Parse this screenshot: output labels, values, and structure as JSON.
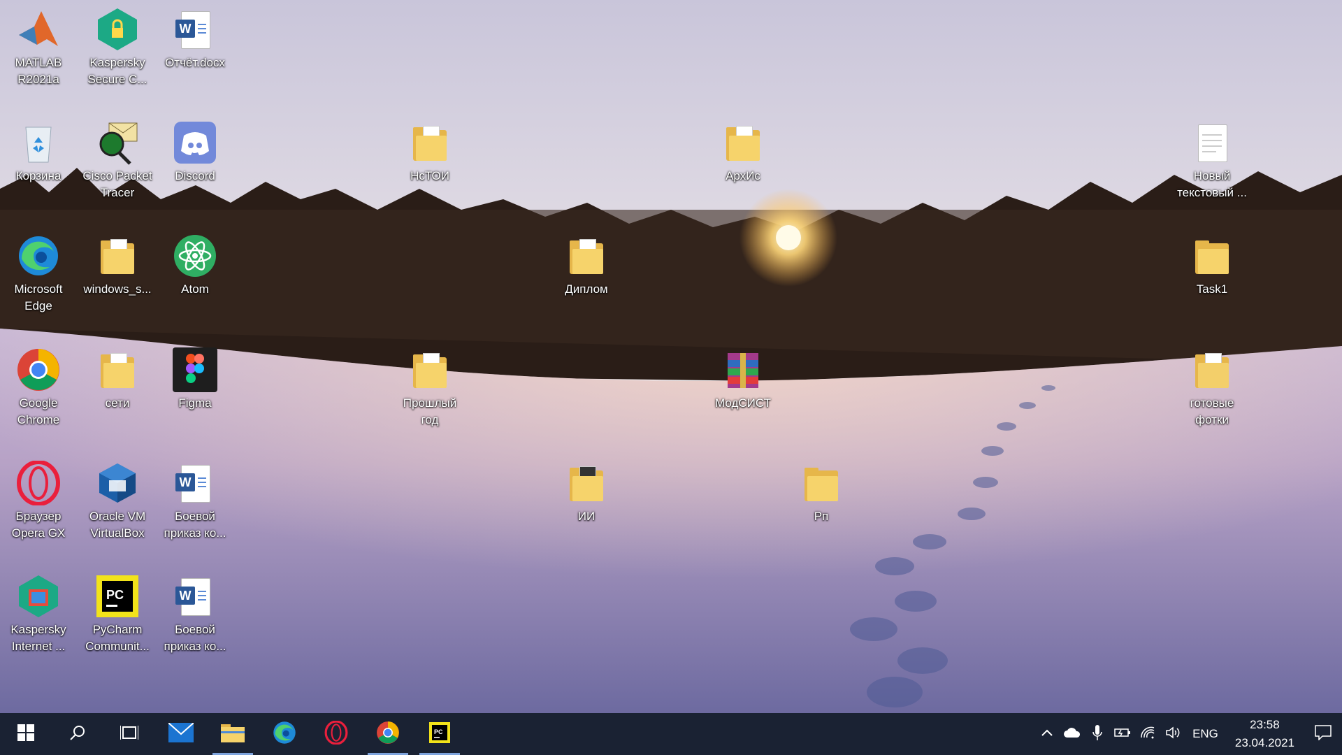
{
  "desktop": {
    "icons": [
      {
        "label": "MATLAB R2021a",
        "icon": "matlab-icon"
      },
      {
        "label": "Kaspersky Secure C...",
        "icon": "kaspersky-secure-icon"
      },
      {
        "label": "Отчёт.docx",
        "icon": "word-doc-icon"
      },
      {
        "label": "Корзина",
        "icon": "recycle-bin-icon"
      },
      {
        "label": "Cisco Packet Tracer",
        "icon": "cisco-packet-tracer-icon"
      },
      {
        "label": "Discord",
        "icon": "discord-icon"
      },
      {
        "label": "НсТОИ",
        "icon": "folder-icon"
      },
      {
        "label": "АрхИс",
        "icon": "folder-icon"
      },
      {
        "label": "Новый текстовый ...",
        "icon": "text-file-icon"
      },
      {
        "label": "Microsoft Edge",
        "icon": "edge-icon"
      },
      {
        "label": "windows_s...",
        "icon": "folder-icon"
      },
      {
        "label": "Atom",
        "icon": "atom-icon"
      },
      {
        "label": "Диплом",
        "icon": "folder-icon"
      },
      {
        "label": "Task1",
        "icon": "folder-icon"
      },
      {
        "label": "Google Chrome",
        "icon": "chrome-icon"
      },
      {
        "label": "сети",
        "icon": "folder-icon"
      },
      {
        "label": "Figma",
        "icon": "figma-icon"
      },
      {
        "label": "Прошлый год",
        "icon": "folder-icon"
      },
      {
        "label": "МодСИСТ",
        "icon": "archive-icon"
      },
      {
        "label": "готовые фотки",
        "icon": "folder-icon"
      },
      {
        "label": "Браузер Opera GX",
        "icon": "opera-gx-icon"
      },
      {
        "label": "Oracle VM VirtualBox",
        "icon": "virtualbox-icon"
      },
      {
        "label": "Боевой приказ ко...",
        "icon": "word-doc-icon"
      },
      {
        "label": "ИИ",
        "icon": "folder-icon"
      },
      {
        "label": "Рп",
        "icon": "folder-icon"
      },
      {
        "label": "Kaspersky Internet ...",
        "icon": "kaspersky-internet-icon"
      },
      {
        "label": "PyCharm Communit...",
        "icon": "pycharm-icon"
      },
      {
        "label": "Боевой приказ ко...",
        "icon": "word-doc-icon"
      }
    ]
  },
  "taskbar": {
    "pinned": [
      {
        "name": "start",
        "icon": "windows-start-icon"
      },
      {
        "name": "search",
        "icon": "search-icon"
      },
      {
        "name": "task-view",
        "icon": "task-view-icon"
      },
      {
        "name": "mail",
        "icon": "mail-icon"
      },
      {
        "name": "file-explorer",
        "icon": "folder-icon"
      },
      {
        "name": "edge",
        "icon": "edge-icon"
      },
      {
        "name": "opera",
        "icon": "opera-icon"
      },
      {
        "name": "chrome",
        "icon": "chrome-icon"
      },
      {
        "name": "pycharm",
        "icon": "pycharm-icon"
      }
    ],
    "tray": {
      "language": "ENG",
      "time": "23:58",
      "date": "23.04.2021"
    }
  },
  "colors": {
    "taskbar_bg": "#1a2233",
    "active_indicator": "#7ea4dd"
  }
}
